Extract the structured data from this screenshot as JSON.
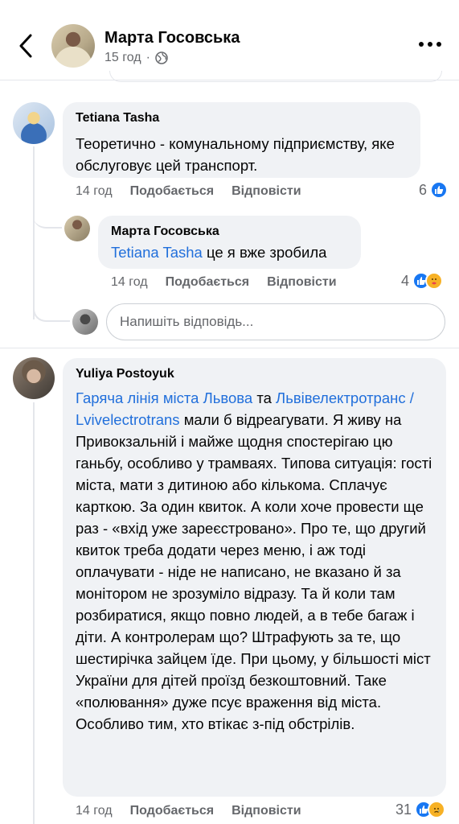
{
  "header": {
    "name": "Марта Госовська",
    "time": "15 год",
    "back_icon": "chevron-left-icon",
    "privacy_icon": "globe-icon",
    "more_icon": "more-horizontal-icon"
  },
  "comments": [
    {
      "author": "Tetiana Tasha",
      "text": "Теоретично - комунальному підприємству, яке обслуговує цей транспорт.",
      "time": "14 год",
      "like_label": "Подобається",
      "reply_label": "Відповісти",
      "reaction_count": "6",
      "reactions": [
        "like"
      ]
    },
    {
      "author": "Марта Госовська",
      "mention": "Tetiana Tasha",
      "text": " це я вже зробила",
      "time": "14 год",
      "like_label": "Подобається",
      "reply_label": "Відповісти",
      "reaction_count": "4",
      "reactions": [
        "like",
        "care"
      ]
    },
    {
      "author": "Yuliya Postoyuk",
      "mention1": "Гаряча лінія міста Львова",
      "between": " та ",
      "mention2": "Львівелектротранс / Lvivelectrotrans",
      "text": " мали б відреагувати. Я живу на Привокзальній і майже щодня спостерігаю цю ганьбу, особливо у трамваях. Типова ситуація: гості міста, мати з дитиною або кількома. Сплачує карткою. За один квиток. А коли хоче провести ще раз - «вхід уже зареєстровано». Про те, що другий квиток треба додати через меню, і аж тоді оплачувати - ніде не написано, не вказано й за монітором не зрозуміло відразу. Та й коли там розбиратися, якщо повно людей, а в тебе багаж і діти. А контролерам що? Штрафують за те, що шестирічка зайцем їде. При цьому, у більшості міст України для дітей проїзд безкоштовний. Таке «полювання» дуже псує враження від міста. Особливо тим, хто втікає з-під обстрілів.",
      "time": "14 год",
      "like_label": "Подобається",
      "reply_label": "Відповісти",
      "reaction_count": "31",
      "reactions": [
        "like",
        "sad"
      ]
    }
  ],
  "reply_box": {
    "placeholder": "Напишіть відповідь..."
  },
  "colors": {
    "link": "#216fdb",
    "bubble": "#f0f2f5",
    "like": "#1877f2",
    "secondary_text": "#65676b"
  }
}
